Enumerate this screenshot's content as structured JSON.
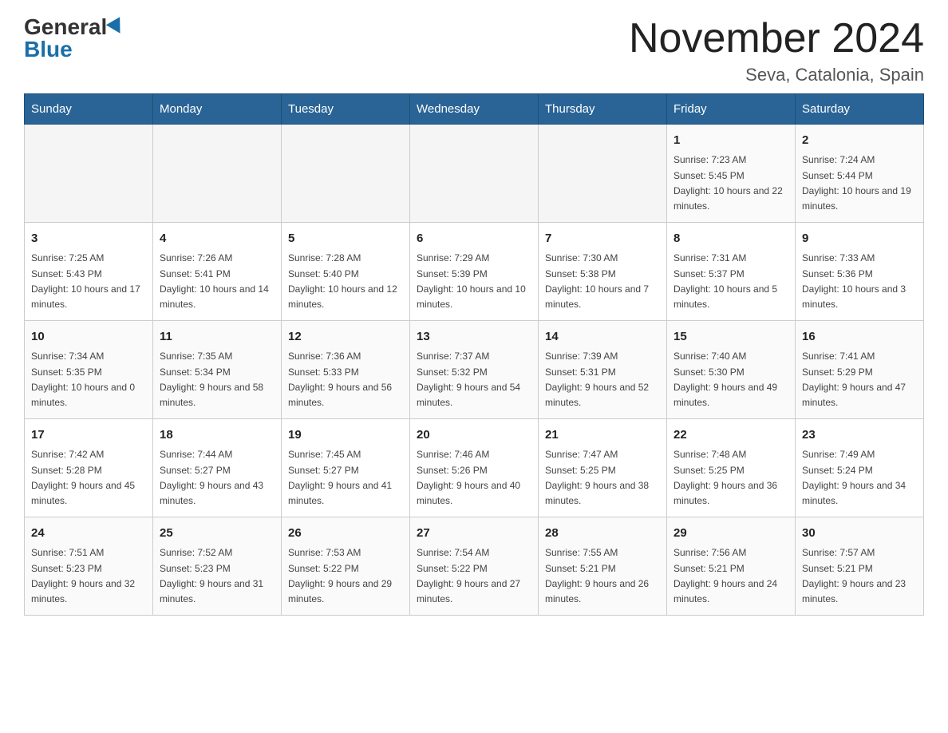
{
  "header": {
    "logo_general": "General",
    "logo_blue": "Blue",
    "month": "November 2024",
    "location": "Seva, Catalonia, Spain"
  },
  "days_of_week": [
    "Sunday",
    "Monday",
    "Tuesday",
    "Wednesday",
    "Thursday",
    "Friday",
    "Saturday"
  ],
  "weeks": [
    [
      {
        "day": "",
        "sunrise": "",
        "sunset": "",
        "daylight": "",
        "empty": true
      },
      {
        "day": "",
        "sunrise": "",
        "sunset": "",
        "daylight": "",
        "empty": true
      },
      {
        "day": "",
        "sunrise": "",
        "sunset": "",
        "daylight": "",
        "empty": true
      },
      {
        "day": "",
        "sunrise": "",
        "sunset": "",
        "daylight": "",
        "empty": true
      },
      {
        "day": "",
        "sunrise": "",
        "sunset": "",
        "daylight": "",
        "empty": true
      },
      {
        "day": "1",
        "sunrise": "Sunrise: 7:23 AM",
        "sunset": "Sunset: 5:45 PM",
        "daylight": "Daylight: 10 hours and 22 minutes.",
        "empty": false
      },
      {
        "day": "2",
        "sunrise": "Sunrise: 7:24 AM",
        "sunset": "Sunset: 5:44 PM",
        "daylight": "Daylight: 10 hours and 19 minutes.",
        "empty": false
      }
    ],
    [
      {
        "day": "3",
        "sunrise": "Sunrise: 7:25 AM",
        "sunset": "Sunset: 5:43 PM",
        "daylight": "Daylight: 10 hours and 17 minutes.",
        "empty": false
      },
      {
        "day": "4",
        "sunrise": "Sunrise: 7:26 AM",
        "sunset": "Sunset: 5:41 PM",
        "daylight": "Daylight: 10 hours and 14 minutes.",
        "empty": false
      },
      {
        "day": "5",
        "sunrise": "Sunrise: 7:28 AM",
        "sunset": "Sunset: 5:40 PM",
        "daylight": "Daylight: 10 hours and 12 minutes.",
        "empty": false
      },
      {
        "day": "6",
        "sunrise": "Sunrise: 7:29 AM",
        "sunset": "Sunset: 5:39 PM",
        "daylight": "Daylight: 10 hours and 10 minutes.",
        "empty": false
      },
      {
        "day": "7",
        "sunrise": "Sunrise: 7:30 AM",
        "sunset": "Sunset: 5:38 PM",
        "daylight": "Daylight: 10 hours and 7 minutes.",
        "empty": false
      },
      {
        "day": "8",
        "sunrise": "Sunrise: 7:31 AM",
        "sunset": "Sunset: 5:37 PM",
        "daylight": "Daylight: 10 hours and 5 minutes.",
        "empty": false
      },
      {
        "day": "9",
        "sunrise": "Sunrise: 7:33 AM",
        "sunset": "Sunset: 5:36 PM",
        "daylight": "Daylight: 10 hours and 3 minutes.",
        "empty": false
      }
    ],
    [
      {
        "day": "10",
        "sunrise": "Sunrise: 7:34 AM",
        "sunset": "Sunset: 5:35 PM",
        "daylight": "Daylight: 10 hours and 0 minutes.",
        "empty": false
      },
      {
        "day": "11",
        "sunrise": "Sunrise: 7:35 AM",
        "sunset": "Sunset: 5:34 PM",
        "daylight": "Daylight: 9 hours and 58 minutes.",
        "empty": false
      },
      {
        "day": "12",
        "sunrise": "Sunrise: 7:36 AM",
        "sunset": "Sunset: 5:33 PM",
        "daylight": "Daylight: 9 hours and 56 minutes.",
        "empty": false
      },
      {
        "day": "13",
        "sunrise": "Sunrise: 7:37 AM",
        "sunset": "Sunset: 5:32 PM",
        "daylight": "Daylight: 9 hours and 54 minutes.",
        "empty": false
      },
      {
        "day": "14",
        "sunrise": "Sunrise: 7:39 AM",
        "sunset": "Sunset: 5:31 PM",
        "daylight": "Daylight: 9 hours and 52 minutes.",
        "empty": false
      },
      {
        "day": "15",
        "sunrise": "Sunrise: 7:40 AM",
        "sunset": "Sunset: 5:30 PM",
        "daylight": "Daylight: 9 hours and 49 minutes.",
        "empty": false
      },
      {
        "day": "16",
        "sunrise": "Sunrise: 7:41 AM",
        "sunset": "Sunset: 5:29 PM",
        "daylight": "Daylight: 9 hours and 47 minutes.",
        "empty": false
      }
    ],
    [
      {
        "day": "17",
        "sunrise": "Sunrise: 7:42 AM",
        "sunset": "Sunset: 5:28 PM",
        "daylight": "Daylight: 9 hours and 45 minutes.",
        "empty": false
      },
      {
        "day": "18",
        "sunrise": "Sunrise: 7:44 AM",
        "sunset": "Sunset: 5:27 PM",
        "daylight": "Daylight: 9 hours and 43 minutes.",
        "empty": false
      },
      {
        "day": "19",
        "sunrise": "Sunrise: 7:45 AM",
        "sunset": "Sunset: 5:27 PM",
        "daylight": "Daylight: 9 hours and 41 minutes.",
        "empty": false
      },
      {
        "day": "20",
        "sunrise": "Sunrise: 7:46 AM",
        "sunset": "Sunset: 5:26 PM",
        "daylight": "Daylight: 9 hours and 40 minutes.",
        "empty": false
      },
      {
        "day": "21",
        "sunrise": "Sunrise: 7:47 AM",
        "sunset": "Sunset: 5:25 PM",
        "daylight": "Daylight: 9 hours and 38 minutes.",
        "empty": false
      },
      {
        "day": "22",
        "sunrise": "Sunrise: 7:48 AM",
        "sunset": "Sunset: 5:25 PM",
        "daylight": "Daylight: 9 hours and 36 minutes.",
        "empty": false
      },
      {
        "day": "23",
        "sunrise": "Sunrise: 7:49 AM",
        "sunset": "Sunset: 5:24 PM",
        "daylight": "Daylight: 9 hours and 34 minutes.",
        "empty": false
      }
    ],
    [
      {
        "day": "24",
        "sunrise": "Sunrise: 7:51 AM",
        "sunset": "Sunset: 5:23 PM",
        "daylight": "Daylight: 9 hours and 32 minutes.",
        "empty": false
      },
      {
        "day": "25",
        "sunrise": "Sunrise: 7:52 AM",
        "sunset": "Sunset: 5:23 PM",
        "daylight": "Daylight: 9 hours and 31 minutes.",
        "empty": false
      },
      {
        "day": "26",
        "sunrise": "Sunrise: 7:53 AM",
        "sunset": "Sunset: 5:22 PM",
        "daylight": "Daylight: 9 hours and 29 minutes.",
        "empty": false
      },
      {
        "day": "27",
        "sunrise": "Sunrise: 7:54 AM",
        "sunset": "Sunset: 5:22 PM",
        "daylight": "Daylight: 9 hours and 27 minutes.",
        "empty": false
      },
      {
        "day": "28",
        "sunrise": "Sunrise: 7:55 AM",
        "sunset": "Sunset: 5:21 PM",
        "daylight": "Daylight: 9 hours and 26 minutes.",
        "empty": false
      },
      {
        "day": "29",
        "sunrise": "Sunrise: 7:56 AM",
        "sunset": "Sunset: 5:21 PM",
        "daylight": "Daylight: 9 hours and 24 minutes.",
        "empty": false
      },
      {
        "day": "30",
        "sunrise": "Sunrise: 7:57 AM",
        "sunset": "Sunset: 5:21 PM",
        "daylight": "Daylight: 9 hours and 23 minutes.",
        "empty": false
      }
    ]
  ]
}
